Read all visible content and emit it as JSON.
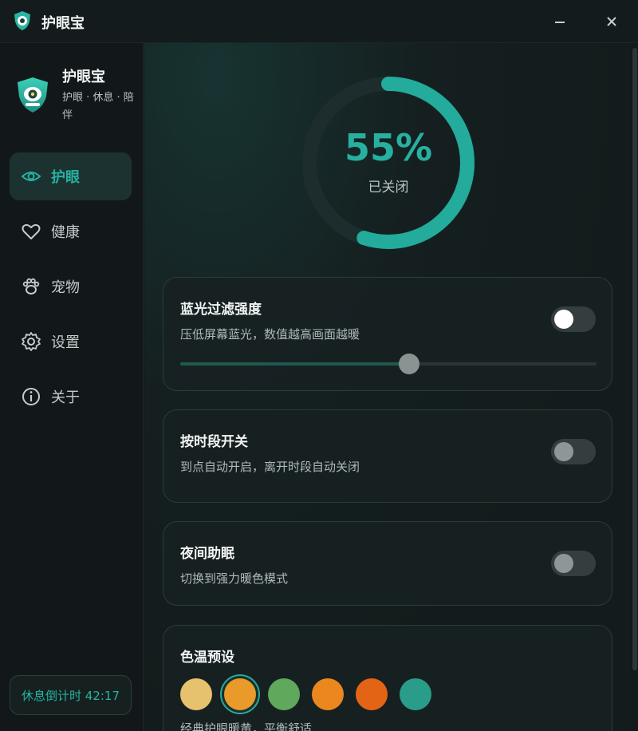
{
  "window": {
    "title": "护眼宝"
  },
  "brand": {
    "name": "护眼宝",
    "subtitle": "护眼 · 休息 · 陪伴"
  },
  "nav": [
    {
      "label": "护眼",
      "icon": "eye-icon",
      "active": true
    },
    {
      "label": "健康",
      "icon": "heart-icon",
      "active": false
    },
    {
      "label": "宠物",
      "icon": "paw-icon",
      "active": false
    },
    {
      "label": "设置",
      "icon": "gear-icon",
      "active": false
    },
    {
      "label": "关于",
      "icon": "info-icon",
      "active": false
    }
  ],
  "countdown": {
    "text": "休息倒计时 42:17"
  },
  "gauge": {
    "value_text": "55%",
    "value": 0.55,
    "status": "已关闭"
  },
  "cards": {
    "filter": {
      "title": "蓝光过滤强度",
      "desc": "压低屏幕蓝光，数值越高画面越暖",
      "toggle_on": false,
      "slider_value": 0.55
    },
    "schedule": {
      "title": "按时段开关",
      "desc": "到点自动开启，离开时段自动关闭",
      "toggle_on": false
    },
    "night": {
      "title": "夜间助眠",
      "desc": "切换到强力暖色模式",
      "toggle_on": false
    },
    "preset": {
      "title": "色温预设",
      "desc": "经典护眼暖黄，平衡舒适",
      "swatches": [
        "#e6c16e",
        "#e89a2a",
        "#5fa85c",
        "#ea871e",
        "#e46416",
        "#2a9c8a"
      ],
      "selected_index": 1
    }
  },
  "colors": {
    "accent": "#27b0a0"
  }
}
